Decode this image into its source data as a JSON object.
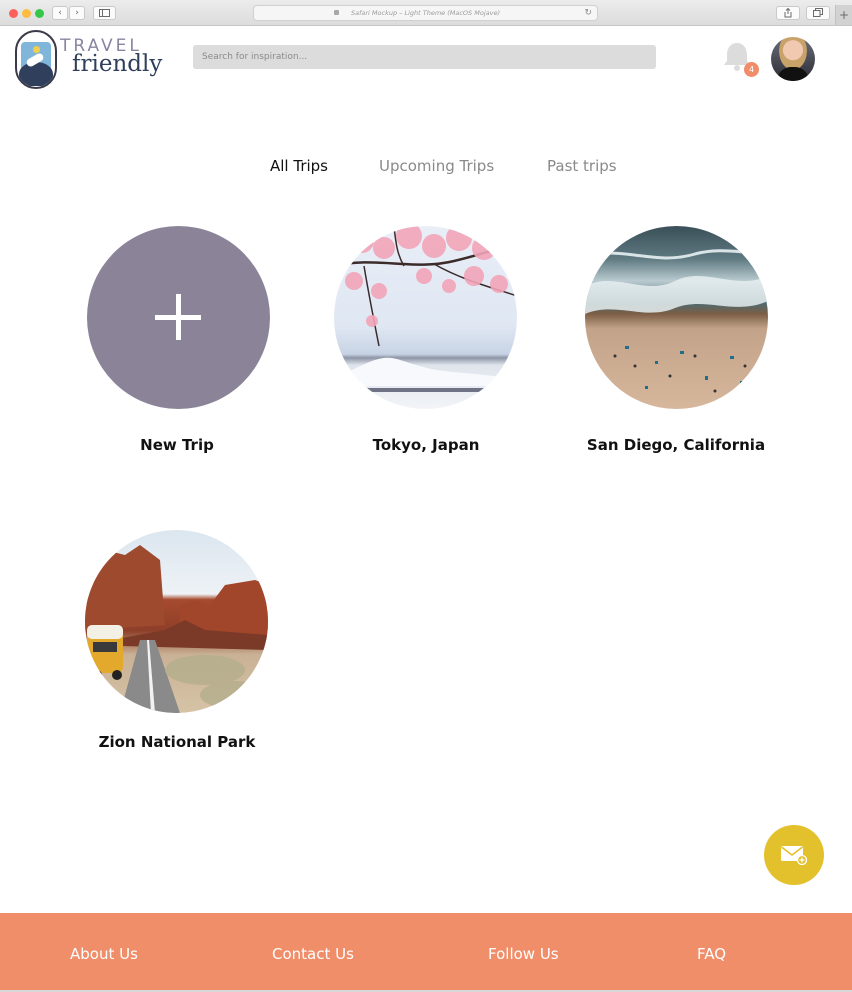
{
  "browser": {
    "address_text": "Safari Mockup – Light Theme (MacOS Mojave)",
    "back_glyph": "‹",
    "forward_glyph": "›",
    "reload_glyph": "↻",
    "new_tab_glyph": "+"
  },
  "header": {
    "logo_top": "TRAVEL",
    "logo_bottom": "friendly",
    "search_placeholder": "Search for inspiration...",
    "notification_count": "4",
    "icons": {
      "notifications": "bell-icon",
      "avatar": "user-avatar"
    }
  },
  "tabs": [
    {
      "label": "All Trips",
      "active": true
    },
    {
      "label": "Upcoming Trips",
      "active": false
    },
    {
      "label": "Past trips",
      "active": false
    }
  ],
  "trips": [
    {
      "label": "New Trip",
      "image": "plus-icon"
    },
    {
      "label": "Tokyo, Japan",
      "image": "cherry-blossom-photo"
    },
    {
      "label": "San Diego, California",
      "image": "aerial-beach-photo"
    },
    {
      "label": "Zion National Park",
      "image": "desert-road-van-photo"
    }
  ],
  "fab": {
    "icon": "mail-add-icon"
  },
  "footer": {
    "links": [
      "About Us",
      "Contact Us",
      "Follow Us",
      "FAQ"
    ]
  },
  "colors": {
    "footer_bg": "#f08e6a",
    "fab_bg": "#e3c12c",
    "new_trip_circle": "#8b8499",
    "notification_badge": "#f08e6a",
    "logo_primary": "#2f3f5c",
    "logo_secondary": "#8a84a0"
  }
}
